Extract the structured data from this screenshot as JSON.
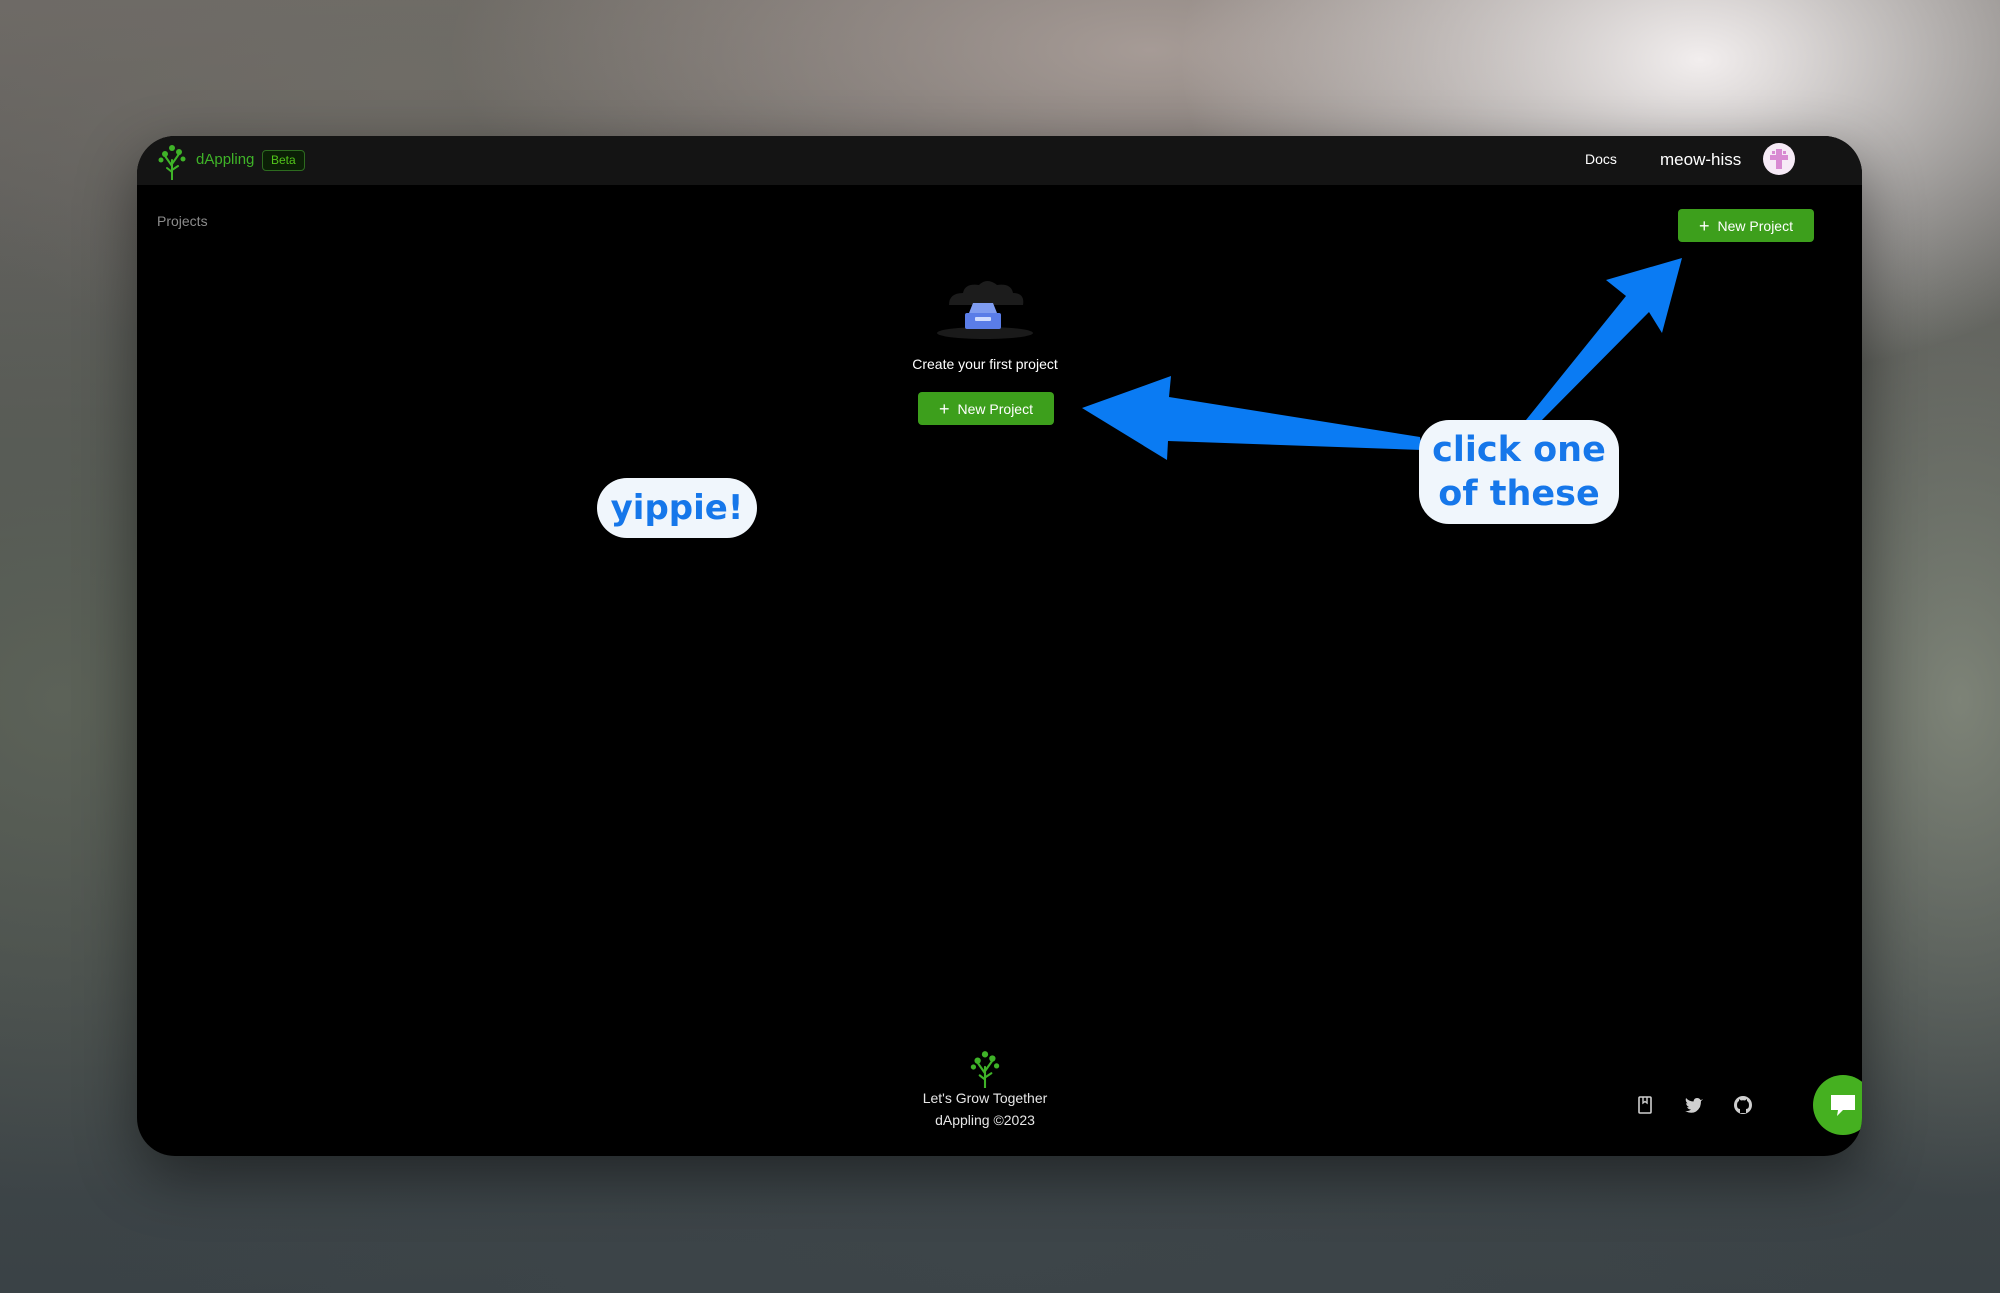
{
  "app": {
    "brand": "dAppling",
    "badge": "Beta",
    "colors": {
      "accent": "#3d9f1c",
      "brand_text": "#3fb328",
      "background": "#000000",
      "topbar": "#141414"
    }
  },
  "header": {
    "docs_label": "Docs",
    "username": "meow-hiss",
    "avatar_icon": "avatar-icon"
  },
  "breadcrumb": {
    "label": "Projects"
  },
  "actions": {
    "new_project_label": "New Project"
  },
  "empty_state": {
    "icon": "empty-inbox-icon",
    "text": "Create your first project",
    "button_label": "New Project"
  },
  "footer": {
    "tagline": "Let's Grow Together",
    "copyright": "dAppling ©2023",
    "icons": [
      "docs-icon",
      "twitter-icon",
      "github-icon"
    ],
    "chat_icon": "chat-icon"
  },
  "annotations": {
    "yippie": "yippie!",
    "click_line1": "click one",
    "click_line2": "of these",
    "arrow_color": "#0a7bf3"
  }
}
